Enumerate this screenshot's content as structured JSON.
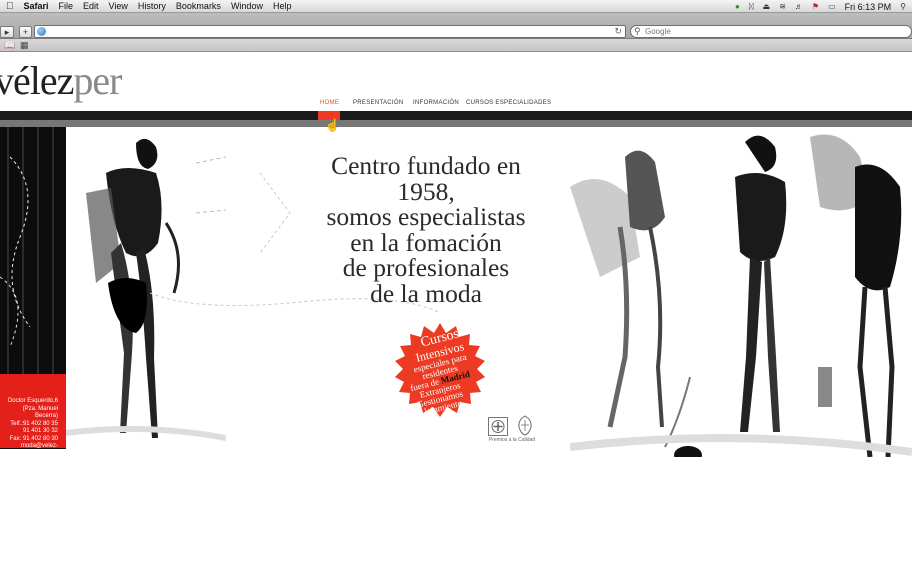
{
  "menubar": {
    "app": "Safari",
    "items": [
      "File",
      "Edit",
      "View",
      "History",
      "Bookmarks",
      "Window",
      "Help"
    ],
    "clock": "Fri 6:13 PM"
  },
  "toolbar": {
    "search_placeholder": "Google"
  },
  "site": {
    "logo_main": "vélez",
    "logo_accent": "per",
    "nav": [
      "HOME",
      "PRESENTACIÓN",
      "INFORMACIÓN",
      "CURSOS ESPECIALIDADES"
    ],
    "active_nav": "HOME",
    "headline": [
      "Centro fundado en",
      "1958,",
      "somos especialistas",
      "en la fomación",
      "de profesionales",
      "de la moda"
    ],
    "seal": {
      "line1": "Cursos",
      "line2": "Intensivos",
      "line3": "especiales para",
      "line4": "residentes",
      "line5_prefix": "fuera de ",
      "line5_city": "Madrid",
      "line6": "Extranjeros",
      "line7": "Gestionamos",
      "line8": "Alojamiento"
    },
    "address": [
      "Doctor Esquerdo,6",
      "(Pza. Manuel Becerra)",
      "Telf.:91 402 80 35",
      "91 401 30 32",
      "Fax: 91 402 80 30",
      "moda@velez-per.com"
    ],
    "quality_label": "Premios a la Calidad"
  },
  "colors": {
    "accent_red": "#ec3a23",
    "nav_bar": "#1b1b1b"
  }
}
